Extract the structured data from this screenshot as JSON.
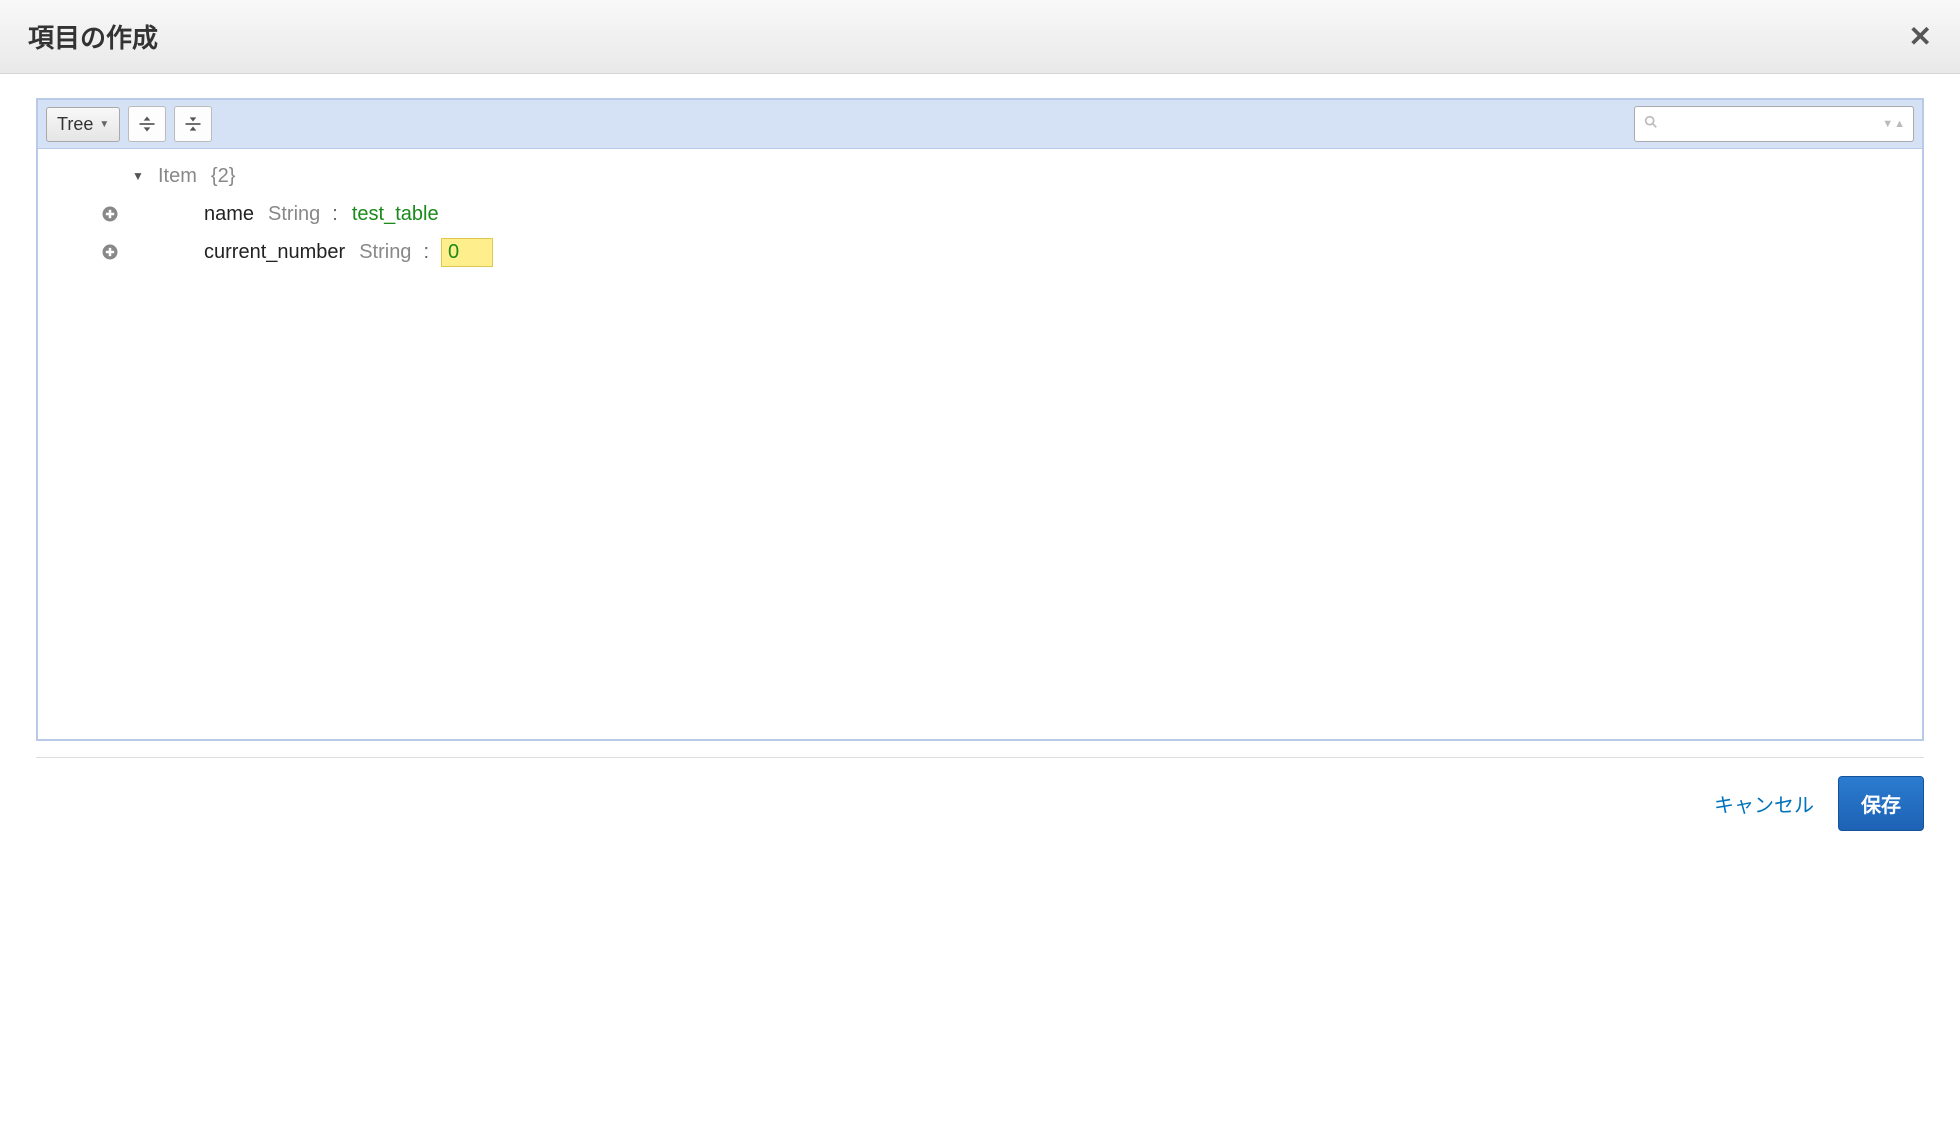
{
  "header": {
    "title": "項目の作成"
  },
  "toolbar": {
    "view_mode": "Tree"
  },
  "editor": {
    "root_label": "Item",
    "root_count": "{2}",
    "fields": [
      {
        "key": "name",
        "type": "String",
        "value": "test_table",
        "highlighted": false
      },
      {
        "key": "current_number",
        "type": "String",
        "value": "0",
        "highlighted": true
      }
    ]
  },
  "footer": {
    "cancel_label": "キャンセル",
    "save_label": "保存"
  }
}
